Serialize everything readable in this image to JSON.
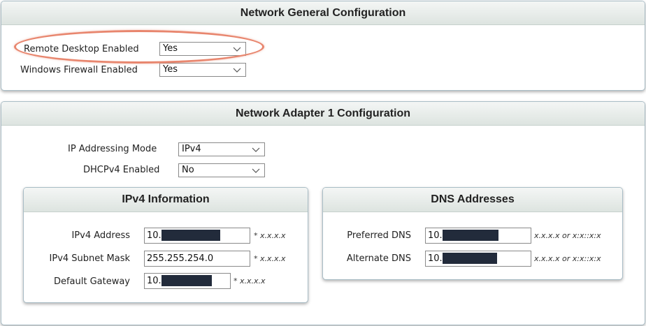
{
  "general": {
    "title": "Network General Configuration",
    "remote_desktop": {
      "label": "Remote Desktop Enabled",
      "value": "Yes"
    },
    "firewall": {
      "label": "Windows Firewall Enabled",
      "value": "Yes"
    }
  },
  "adapter": {
    "title": "Network Adapter 1 Configuration",
    "ip_mode": {
      "label": "IP Addressing Mode",
      "value": "IPv4"
    },
    "dhcp": {
      "label": "DHCPv4 Enabled",
      "value": "No"
    },
    "ipv4": {
      "title": "IPv4 Information",
      "address": {
        "label": "IPv4 Address",
        "value": "10.",
        "hint": "* x.x.x.x"
      },
      "subnet": {
        "label": "IPv4 Subnet Mask",
        "value": "255.255.254.0",
        "hint": "* x.x.x.x"
      },
      "gateway": {
        "label": "Default Gateway",
        "value": "10.",
        "hint": "* x.x.x.x"
      }
    },
    "dns": {
      "title": "DNS Addresses",
      "preferred": {
        "label": "Preferred DNS",
        "value": "10.",
        "hint": "x.x.x.x or x:x::x:x"
      },
      "alternate": {
        "label": "Alternate DNS",
        "value": "10.",
        "hint": "x.x.x.x or x:x::x:x"
      }
    }
  },
  "colors": {
    "highlight": "#e8866e",
    "redaction": "#222b3b"
  }
}
